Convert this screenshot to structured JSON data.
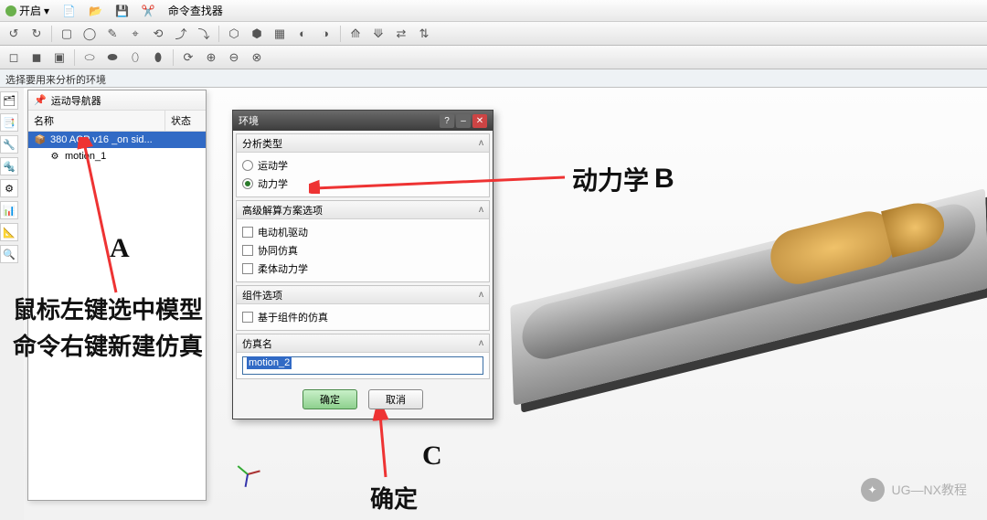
{
  "menu": {
    "start": "开启",
    "cmdsearch": "命令查找器"
  },
  "status": "选择要用来分析的环境",
  "navigator": {
    "title": "运动导航器",
    "col_name": "名称",
    "col_status": "状态",
    "items": [
      {
        "label": "380 ACP v16 _on sid..."
      },
      {
        "label": "motion_1"
      }
    ]
  },
  "dialog": {
    "title": "环境",
    "sec_analysis": "分析类型",
    "radio_kinematics": "运动学",
    "radio_dynamics": "动力学",
    "sec_advanced": "高级解算方案选项",
    "chk_motor": "电动机驱动",
    "chk_cosim": "协同仿真",
    "chk_flex": "柔体动力学",
    "sec_component": "组件选项",
    "chk_compbased": "基于组件的仿真",
    "sec_simname": "仿真名",
    "simname_value": "motion_2",
    "btn_ok": "确定",
    "btn_cancel": "取消"
  },
  "annotations": {
    "A": "A",
    "left_text": "鼠标左键选中模型命令右键新建仿真",
    "C": "C",
    "confirm": "确定",
    "dynamics": "动力学",
    "B": "B"
  },
  "watermark": "UG—NX教程"
}
